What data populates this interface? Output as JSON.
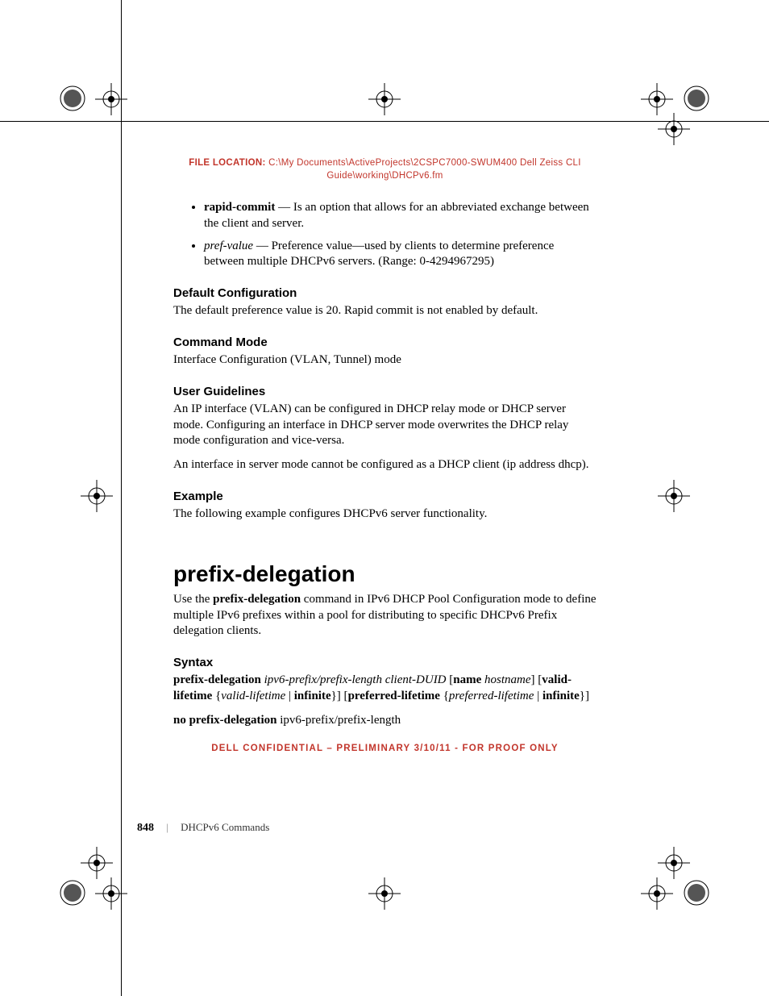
{
  "file_location": {
    "label": "FILE LOCATION:",
    "path_line1": "C:\\My Documents\\ActiveProjects\\2CSPC7000-SWUM400 Dell Zeiss CLI",
    "path_line2": "Guide\\working\\DHCPv6.fm"
  },
  "bullets": {
    "rapid_commit": {
      "term": "rapid-commit",
      "dash": " — ",
      "text": "Is an option that allows for an abbreviated exchange between the client and server."
    },
    "pref_value": {
      "term": "pref-value",
      "dash": " — ",
      "text": "Preference value—used by clients to determine preference between multiple DHCPv6 servers. (Range: 0-4294967295)"
    }
  },
  "sections": {
    "default_cfg": {
      "heading": "Default Configuration",
      "body": "The default preference value is 20. Rapid commit is not enabled by default."
    },
    "cmd_mode": {
      "heading": "Command Mode",
      "body": "Interface Configuration (VLAN, Tunnel) mode"
    },
    "user_guidelines": {
      "heading": "User Guidelines",
      "p1": "An IP interface (VLAN) can be configured in DHCP relay mode or DHCP server mode. Configuring an interface in DHCP server mode overwrites the DHCP relay mode configuration and vice-versa.",
      "p2": "An interface in server mode cannot be configured as a DHCP client (ip address dhcp)."
    },
    "example": {
      "heading": "Example",
      "body": "The following example configures DHCPv6 server functionality."
    }
  },
  "command": {
    "title": "prefix-delegation",
    "intro_pre": "Use the ",
    "intro_bold": "prefix-delegation",
    "intro_post": " command in IPv6 DHCP Pool Configuration mode to define multiple IPv6 prefixes within a pool for distributing to specific DHCPv6 Prefix delegation clients."
  },
  "syntax": {
    "heading": "Syntax",
    "line1": {
      "b1": "prefix-delegation ",
      "i1": "ipv6-prefix/prefix-length client-DUID ",
      "t1": "[",
      "b2": "name ",
      "i2": "hostname",
      "t2": "] [",
      "b3": "valid-lifetime ",
      "t3": "{",
      "i3": "valid-lifetime",
      "t4": " | ",
      "b4": "infinite",
      "t5": "}] [",
      "b5": "preferred-lifetime ",
      "t6": "{",
      "i4": "preferred-lifetime",
      "t7": " | ",
      "b6": "infinite",
      "t8": "}]"
    },
    "line2": {
      "b1": "no prefix-delegation ",
      "t1": "ipv6-prefix/prefix-length"
    }
  },
  "confidential": "DELL CONFIDENTIAL – PRELIMINARY 3/10/11 - FOR PROOF ONLY",
  "footer": {
    "page": "848",
    "sep": "|",
    "chapter": "DHCPv6 Commands"
  }
}
